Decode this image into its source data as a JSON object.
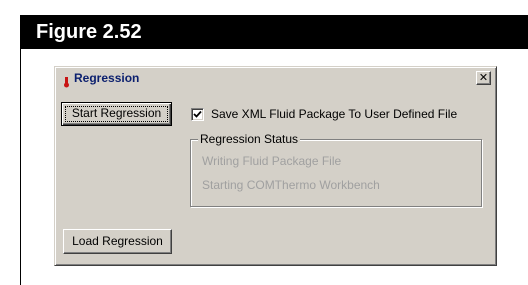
{
  "figure": {
    "label": "Figure 2.52"
  },
  "dialog": {
    "title": "Regression",
    "close_glyph": "✕",
    "title_icon": "thermometer-icon",
    "start_button_label": "Start Regression",
    "load_button_label": "Load Regression",
    "save_checkbox": {
      "label": "Save XML Fluid Package To User Defined File",
      "checked": true
    },
    "status_group": {
      "title": "Regression Status",
      "lines": [
        "Writing Fluid Package File",
        "Starting COMThermo Workbench"
      ]
    }
  },
  "colors": {
    "header_bg": "#000000",
    "dialog_face": "#d4d0c8",
    "title_text": "#0b1f6e",
    "disabled_text": "#a0a0a0",
    "icon_red": "#c81414"
  }
}
